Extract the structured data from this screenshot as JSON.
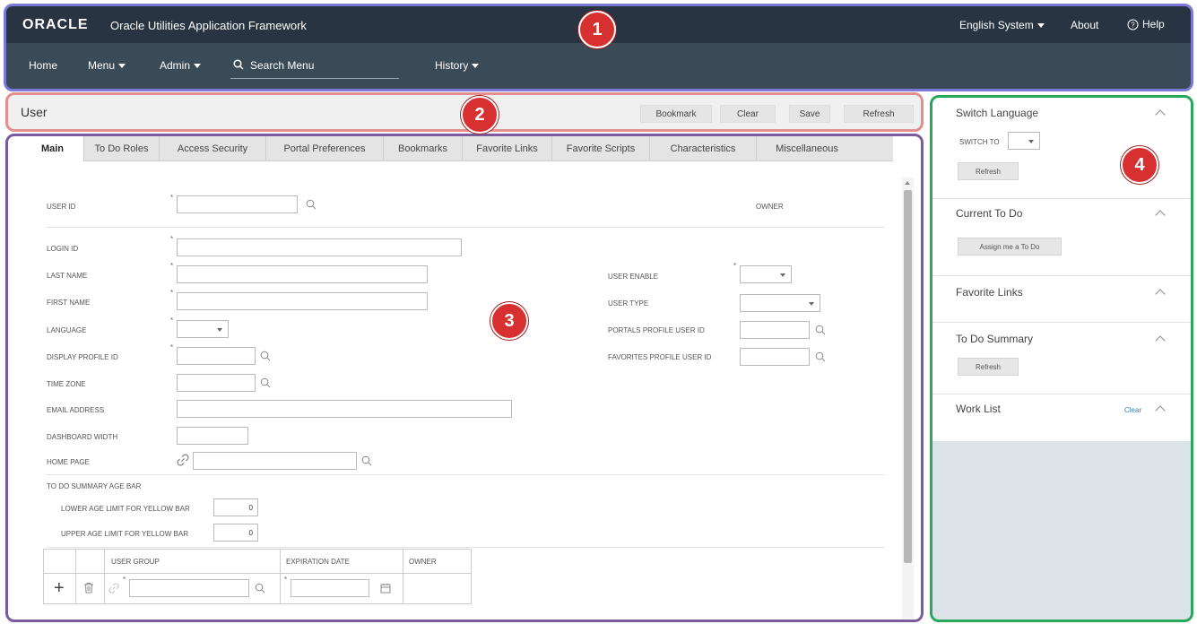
{
  "header": {
    "logo": "ORACLE",
    "app_title": "Oracle Utilities Application Framework",
    "language": "English System",
    "about": "About",
    "help": "Help"
  },
  "nav": {
    "home": "Home",
    "menu": "Menu",
    "admin": "Admin",
    "search_placeholder": "Search Menu",
    "history": "History"
  },
  "badges": [
    "1",
    "2",
    "3",
    "4"
  ],
  "page": {
    "title": "User",
    "bookmark": "Bookmark",
    "clear": "Clear",
    "save": "Save",
    "refresh": "Refresh"
  },
  "tabs": [
    "Main",
    "To Do Roles",
    "Access Security",
    "Portal Preferences",
    "Bookmarks",
    "Favorite Links",
    "Favorite Scripts",
    "Characteristics",
    "Miscellaneous"
  ],
  "form": {
    "user_id": "USER ID",
    "owner": "OWNER",
    "login_id": "LOGIN ID",
    "last_name": "LAST NAME",
    "first_name": "FIRST NAME",
    "language": "LANGUAGE",
    "display_profile_id": "DISPLAY PROFILE ID",
    "time_zone": "TIME ZONE",
    "email_address": "EMAIL ADDRESS",
    "dashboard_width": "DASHBOARD WIDTH",
    "home_page": "HOME PAGE",
    "user_enable": "USER ENABLE",
    "user_type": "USER TYPE",
    "portals_profile_user_id": "PORTALS PROFILE USER ID",
    "favorites_profile_user_id": "FAVORITES PROFILE USER ID",
    "todo_summary_age_bar": "TO DO SUMMARY AGE BAR",
    "lower_age_limit": "LOWER AGE LIMIT FOR YELLOW BAR",
    "lower_age_value": "0",
    "upper_age_limit": "UPPER AGE LIMIT FOR YELLOW BAR",
    "upper_age_value": "0",
    "required_marker": "*"
  },
  "grid": {
    "col_user_group": "USER GROUP",
    "col_expiration_date": "EXPIRATION DATE",
    "col_owner": "OWNER",
    "add": "+"
  },
  "right_panel": {
    "switch_language": "Switch Language",
    "switch_to": "SWITCH TO",
    "refresh1": "Refresh",
    "current_todo": "Current To Do",
    "assign_todo": "Assign me a To Do",
    "favorite_links": "Favorite Links",
    "todo_summary": "To Do Summary",
    "refresh2": "Refresh",
    "work_list": "Work List",
    "clear": "Clear"
  }
}
